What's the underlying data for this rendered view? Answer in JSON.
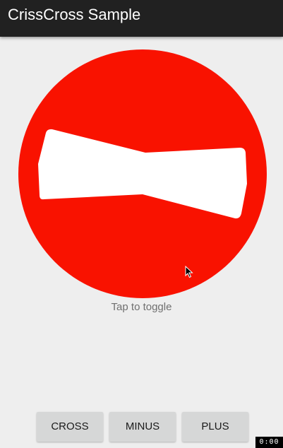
{
  "app_bar": {
    "title": "CrissCross Sample",
    "background": "#212121"
  },
  "toggle_view": {
    "shape": "minus",
    "circle_color": "#f91200",
    "glyph_color": "#ffffff",
    "hint": "Tap to toggle"
  },
  "buttons": {
    "cross": "CROSS",
    "minus": "MINUS",
    "plus": "PLUS"
  },
  "cursor": {
    "icon": "mouse-pointer-icon"
  },
  "recorder": {
    "time": "0:00"
  }
}
